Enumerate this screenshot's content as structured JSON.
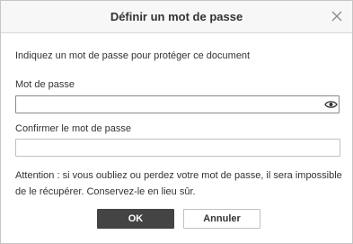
{
  "dialog": {
    "title": "Définir un mot de passe",
    "intro": "Indiquez un mot de passe pour protéger ce document",
    "password_label": "Mot de passe",
    "password_value": "",
    "confirm_label": "Confirmer le mot de passe",
    "confirm_value": "",
    "warning": "Attention : si vous oubliez ou perdez votre mot de passe, il sera impossible de le récupérer. Conservez-le en lieu sûr.",
    "ok_label": "OK",
    "cancel_label": "Annuler"
  },
  "icons": {
    "close": "close-icon",
    "show_password": "eye-icon"
  },
  "colors": {
    "primary_button": "#444444",
    "border": "#c0c0c0",
    "text": "#333333"
  }
}
